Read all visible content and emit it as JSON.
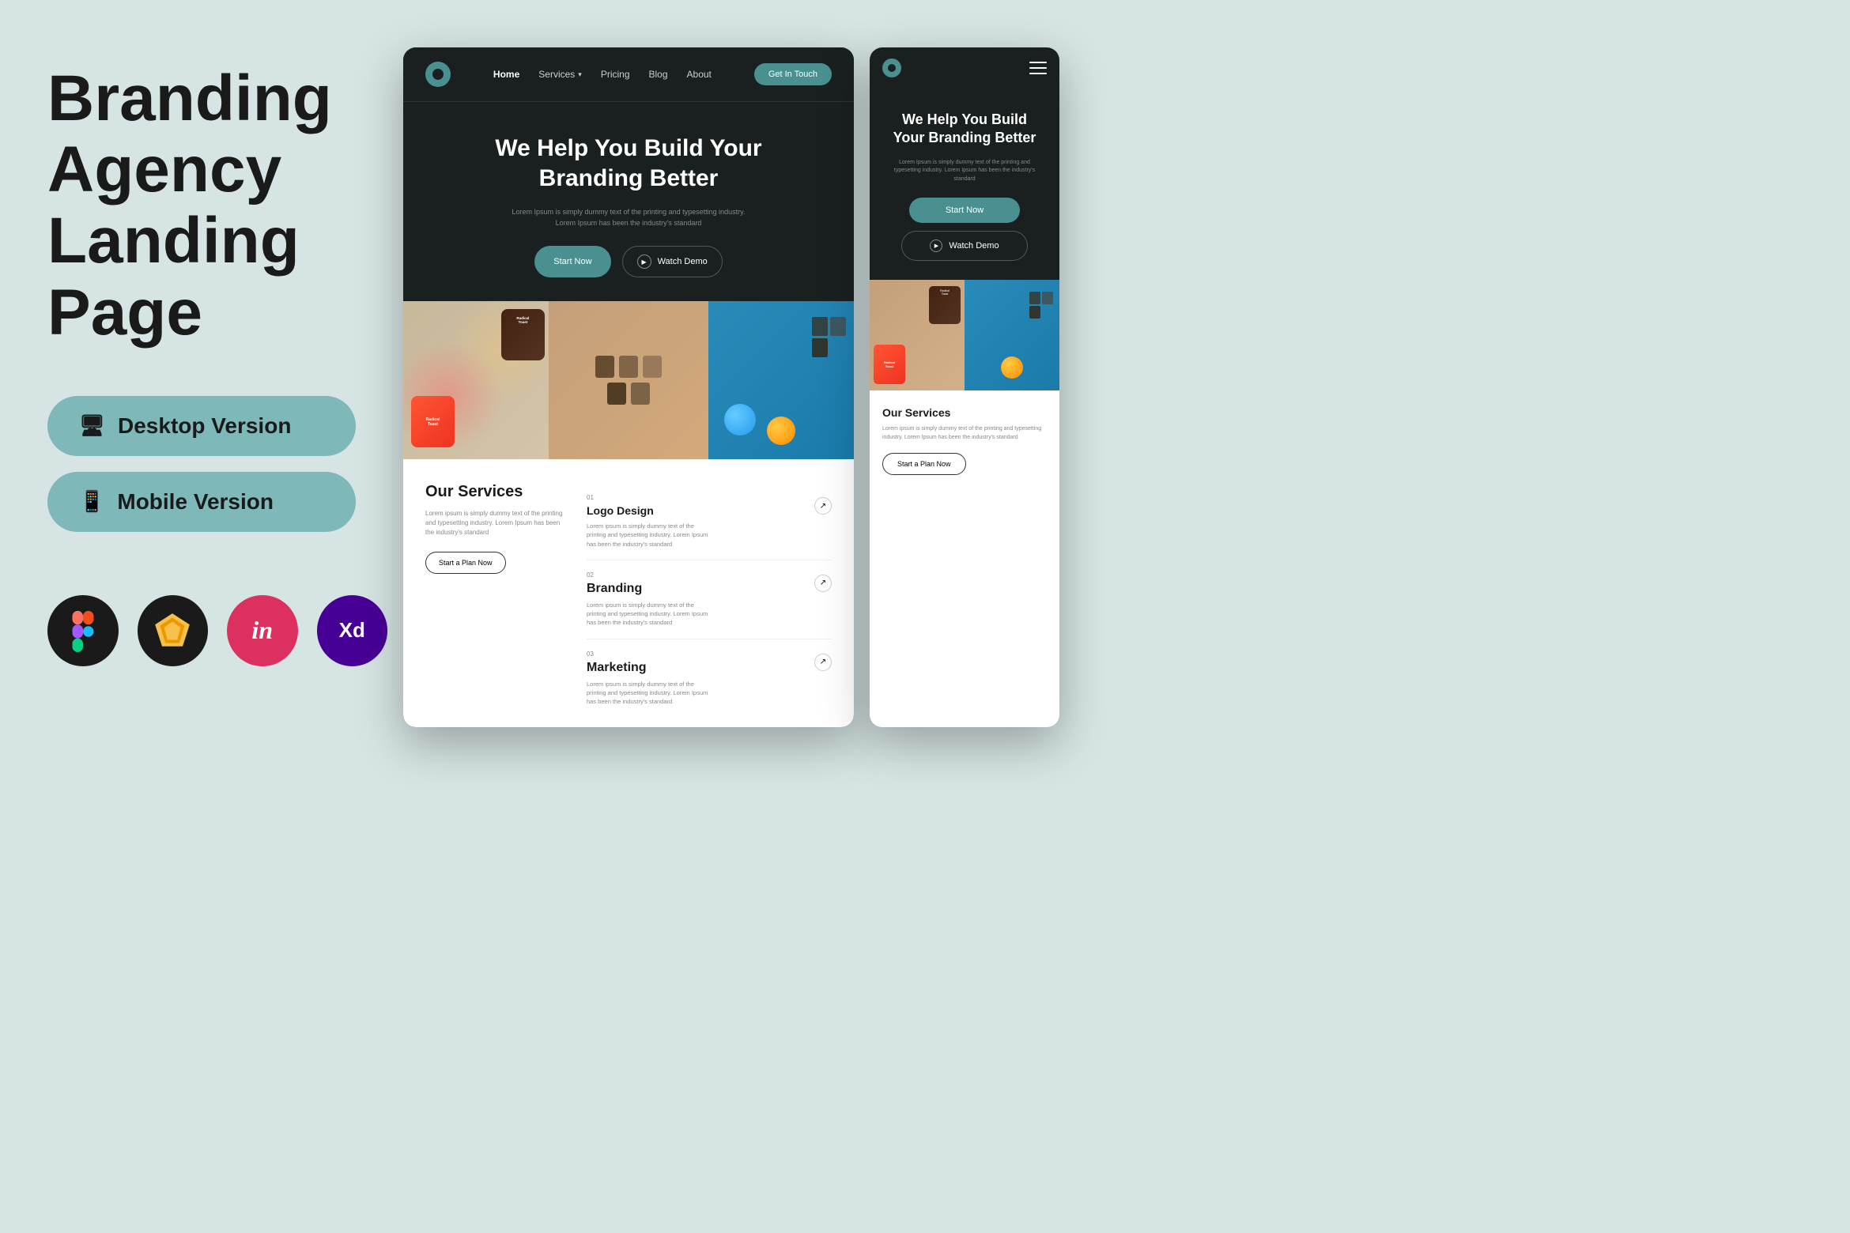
{
  "page": {
    "bg_color": "#d6e4e4"
  },
  "left": {
    "title_line1": "Branding",
    "title_line2": "Agency",
    "title_line3": "Landing Page",
    "desktop_btn": "Desktop Version",
    "mobile_btn": "Mobile Version",
    "tools": [
      "Figma",
      "Sketch",
      "InVision",
      "Adobe XD"
    ]
  },
  "desktop": {
    "nav": {
      "links": [
        "Home",
        "Services",
        "Pricing",
        "Blog",
        "About"
      ],
      "cta": "Get In Touch"
    },
    "hero": {
      "title_line1": "We Help You Build Your",
      "title_line2": "Branding Better",
      "subtitle": "Lorem Ipsum is simply dummy text of the printing and typesetting industry. Lorem Ipsum has been the industry's standard",
      "btn_start": "Start Now",
      "btn_watch": "Watch Demo"
    },
    "services": {
      "title": "Our Services",
      "description": "Lorem ipsum is simply dummy text of the printing and typesetting industry. Lorem Ipsum has been the industry's standard",
      "start_plan_btn": "Start a Plan Now",
      "items": [
        {
          "number": "01",
          "name": "Logo Design",
          "description": "Lorem ipsum is simply dummy text of the printing and typesetting industry. Lorem Ipsum has been the industry's standard"
        },
        {
          "number": "02",
          "name": "Branding",
          "description": "Lorem ipsum is simply dummy text of the printing and typesetting industry. Lorem Ipsum has been the industry's standard"
        },
        {
          "number": "03",
          "name": "Marketing",
          "description": "Lorem ipsum is simply dummy text of the printing and typesetting industry. Lorem Ipsum has been the industry's standard"
        }
      ]
    }
  },
  "mobile": {
    "hero": {
      "title": "We Help You Build Your Branding Better",
      "subtitle": "Lorem Ipsum is simply dummy text of the printing and typesetting industry. Lorem Ipsum has been the industry's standard",
      "btn_start": "Start Now",
      "btn_watch": "Watch Demo"
    },
    "services": {
      "title": "Our Services",
      "description": "Lorem ipsum is simply dummy text of the printing and typesetting industry. Lorem Ipsum has been the industry's standard",
      "start_plan_btn": "Start a Plan Now"
    }
  }
}
